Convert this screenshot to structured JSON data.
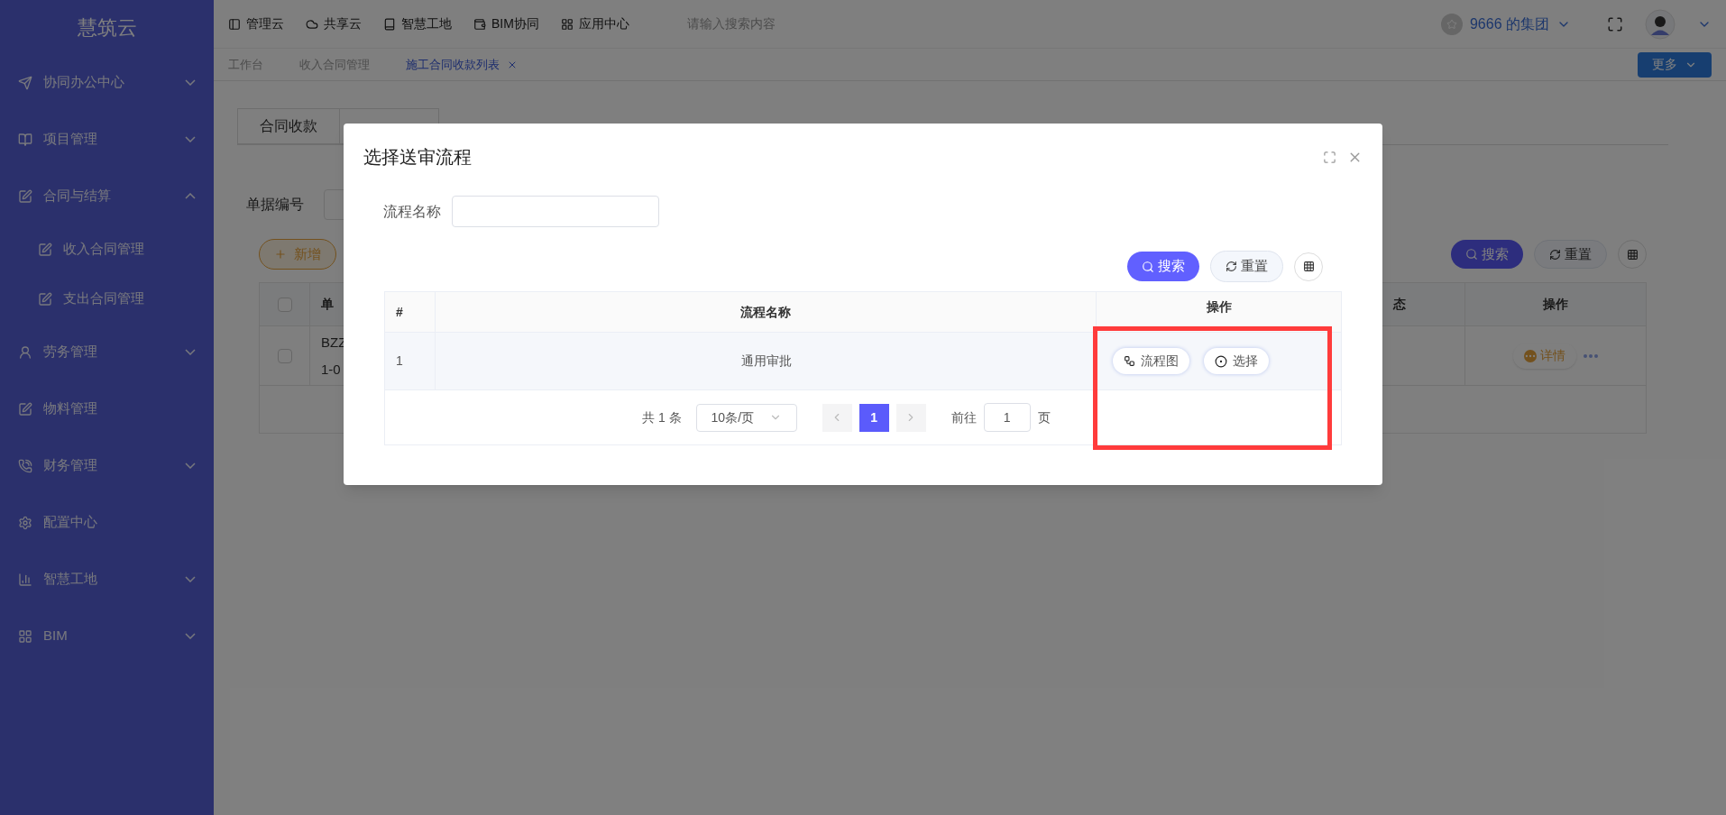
{
  "sidebar": {
    "logo": "慧筑云",
    "items": [
      {
        "label": "协同办公中心",
        "expanded": false
      },
      {
        "label": "项目管理",
        "expanded": false
      },
      {
        "label": "合同与结算",
        "expanded": true,
        "children": [
          {
            "label": "收入合同管理"
          },
          {
            "label": "支出合同管理"
          }
        ]
      },
      {
        "label": "劳务管理",
        "expanded": false
      },
      {
        "label": "物料管理"
      },
      {
        "label": "财务管理",
        "expanded": false
      },
      {
        "label": "配置中心"
      },
      {
        "label": "智慧工地",
        "expanded": false
      },
      {
        "label": "BIM",
        "expanded": false
      }
    ]
  },
  "top_nav": {
    "items": [
      "管理云",
      "共享云",
      "智慧工地",
      "BIM协同",
      "应用中心"
    ],
    "search_placeholder": "请输入搜索内容",
    "group": "9666 的集团"
  },
  "page_tabs": {
    "items": [
      {
        "label": "工作台",
        "selected": false
      },
      {
        "label": "收入合同管理",
        "selected": false
      },
      {
        "label": "施工合同收款列表",
        "selected": true
      }
    ],
    "more": "更多"
  },
  "background": {
    "tabs": [
      "合同收款"
    ],
    "filter_label": "单据编号",
    "add_button": "新增",
    "search_button": "搜索",
    "reset_button": "重置",
    "columns": [
      "单",
      "态",
      "操作"
    ],
    "header_checked": false,
    "row": {
      "checked": false,
      "code_lines": [
        "BZZ",
        "1-0"
      ],
      "detail_button": "详情"
    }
  },
  "dialog": {
    "title": "选择送审流程",
    "filter_label": "流程名称",
    "search_button": "搜索",
    "reset_button": "重置",
    "columns": [
      "#",
      "流程名称",
      "操作"
    ],
    "rows": [
      {
        "cells": [
          "1",
          "通用审批"
        ],
        "actions": [
          "流程图",
          "选择"
        ]
      }
    ],
    "pagination": {
      "total": "共 1 条",
      "page_size": "10条/页",
      "pages": [
        {
          "label": "1",
          "selected": true
        }
      ],
      "goto_label": "前往",
      "goto_value": "1",
      "page_suffix": "页"
    }
  }
}
